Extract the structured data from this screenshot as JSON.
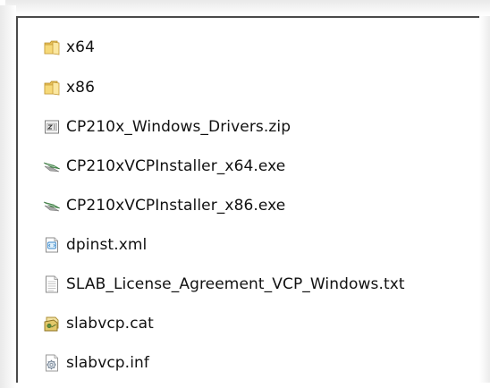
{
  "files": [
    {
      "name": "x64",
      "icon": "folder-icon"
    },
    {
      "name": "x86",
      "icon": "folder-icon"
    },
    {
      "name": "CP210x_Windows_Drivers.zip",
      "icon": "zip-file-icon"
    },
    {
      "name": "CP210xVCPInstaller_x64.exe",
      "icon": "installer-exe-icon"
    },
    {
      "name": "CP210xVCPInstaller_x86.exe",
      "icon": "installer-exe-icon"
    },
    {
      "name": "dpinst.xml",
      "icon": "xml-file-icon"
    },
    {
      "name": "SLAB_License_Agreement_VCP_Windows.txt",
      "icon": "text-file-icon"
    },
    {
      "name": "slabvcp.cat",
      "icon": "security-catalog-icon"
    },
    {
      "name": "slabvcp.inf",
      "icon": "setup-info-file-icon"
    }
  ]
}
